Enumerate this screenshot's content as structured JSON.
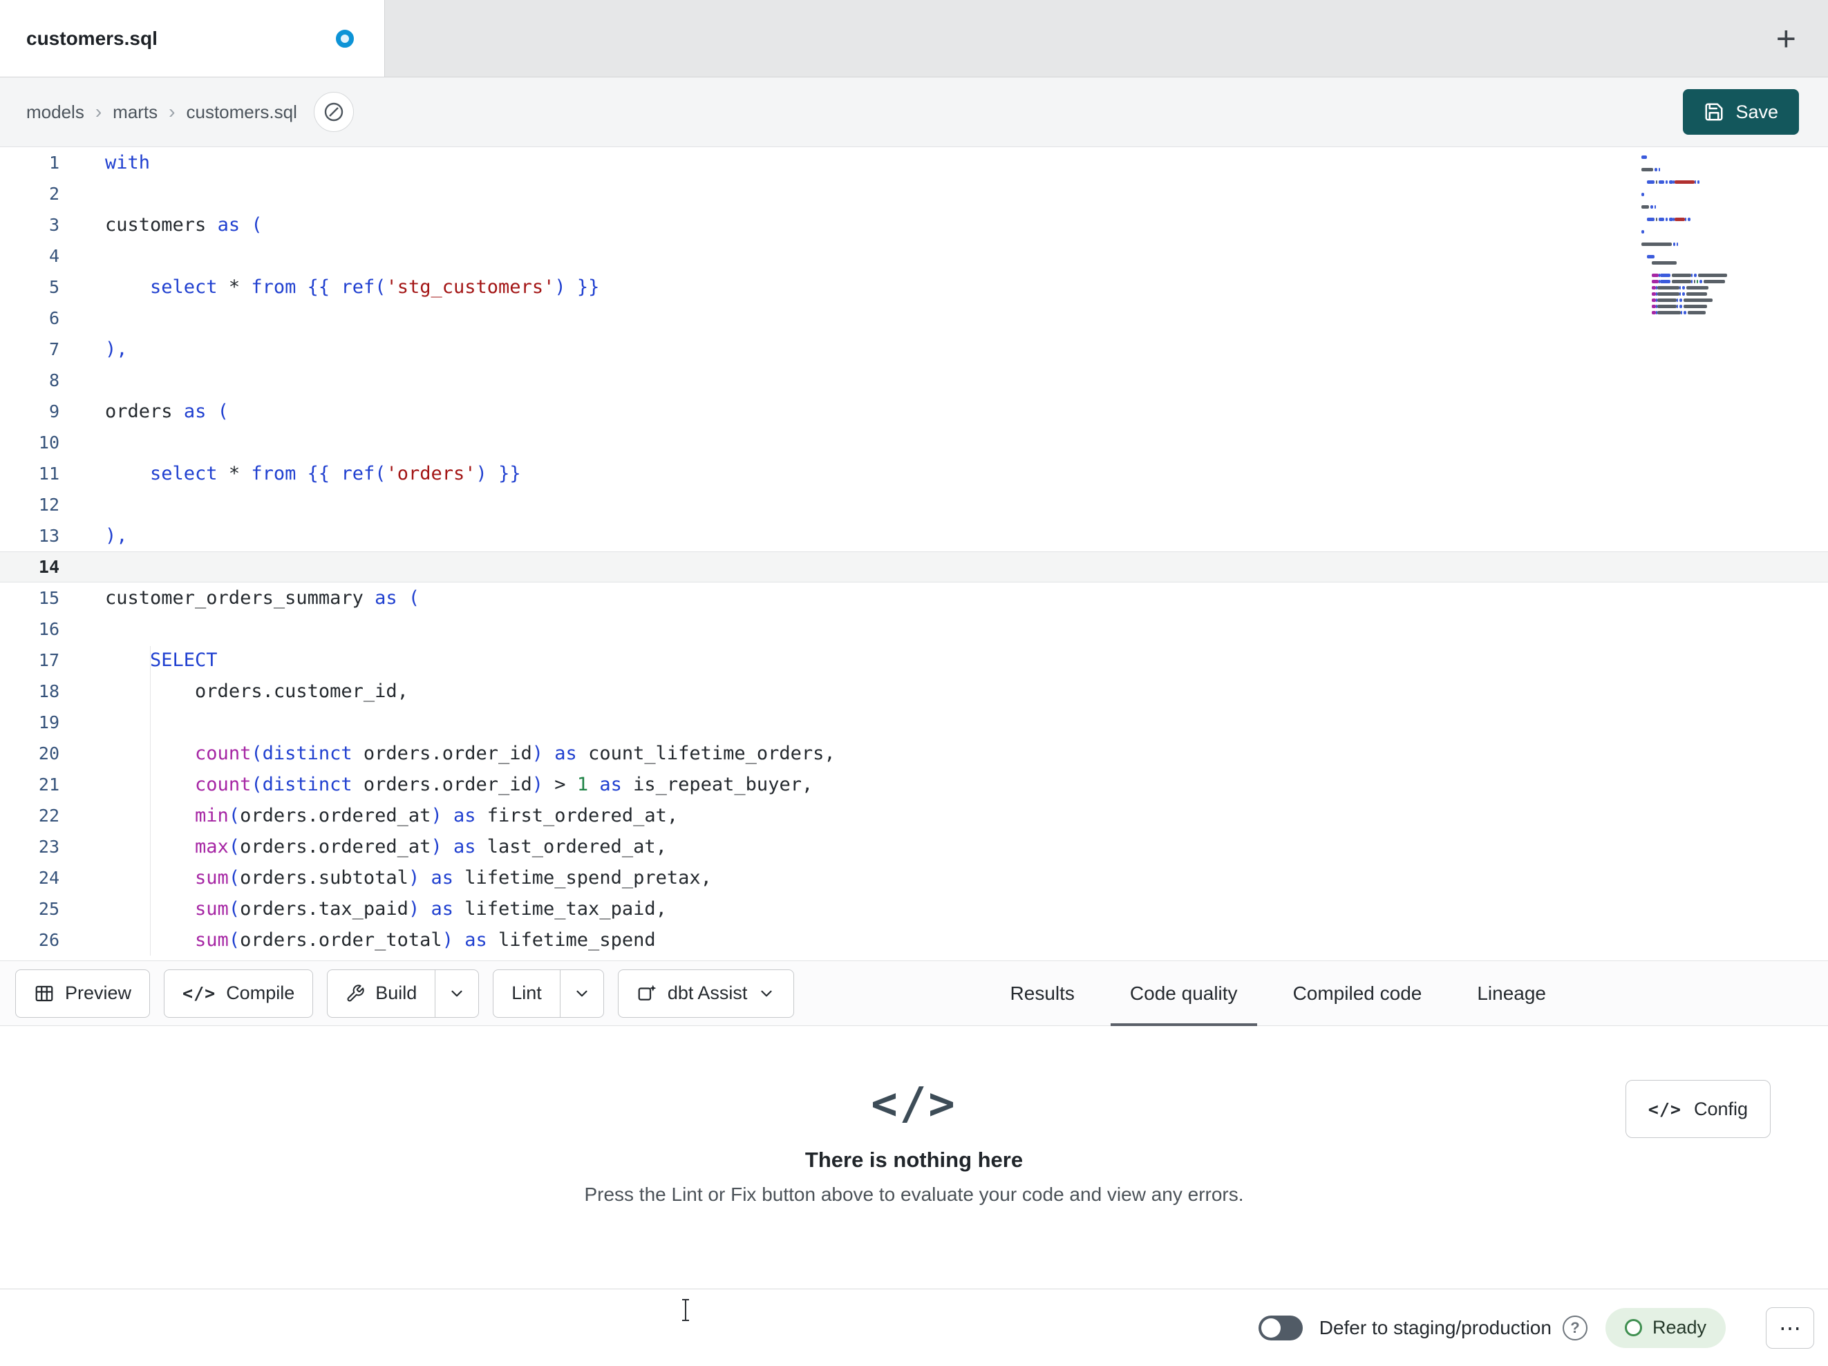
{
  "tab_bar": {
    "active_tab": "customers.sql",
    "new_tab_label": "+"
  },
  "breadcrumb": {
    "items": [
      "models",
      "marts",
      "customers.sql"
    ],
    "separator": "›"
  },
  "save_button": {
    "label": "Save"
  },
  "icons": {
    "code_glyph": "</>"
  },
  "editor": {
    "active_line": 14,
    "lines": [
      {
        "tokens": [
          [
            "with",
            "kw"
          ]
        ]
      },
      {
        "tokens": []
      },
      {
        "tokens": [
          [
            "customers",
            "id"
          ],
          [
            " ",
            "sp"
          ],
          [
            "as",
            "kw"
          ],
          [
            " ",
            "sp"
          ],
          [
            "(",
            "br"
          ]
        ]
      },
      {
        "tokens": []
      },
      {
        "tokens": [
          [
            "    ",
            "sp"
          ],
          [
            "select",
            "kw"
          ],
          [
            " ",
            "sp"
          ],
          [
            "*",
            "op"
          ],
          [
            " ",
            "sp"
          ],
          [
            "from",
            "kw"
          ],
          [
            " ",
            "sp"
          ],
          [
            "{{",
            "jin"
          ],
          [
            " ",
            "sp"
          ],
          [
            "ref",
            "kw"
          ],
          [
            "(",
            "br"
          ],
          [
            "'stg_customers'",
            "str"
          ],
          [
            ")",
            "br"
          ],
          [
            " ",
            "sp"
          ],
          [
            "}}",
            "jin"
          ]
        ]
      },
      {
        "tokens": []
      },
      {
        "tokens": [
          [
            "),",
            "br"
          ]
        ]
      },
      {
        "tokens": []
      },
      {
        "tokens": [
          [
            "orders",
            "id"
          ],
          [
            " ",
            "sp"
          ],
          [
            "as",
            "kw"
          ],
          [
            " ",
            "sp"
          ],
          [
            "(",
            "br"
          ]
        ]
      },
      {
        "tokens": []
      },
      {
        "tokens": [
          [
            "    ",
            "sp"
          ],
          [
            "select",
            "kw"
          ],
          [
            " ",
            "sp"
          ],
          [
            "*",
            "op"
          ],
          [
            " ",
            "sp"
          ],
          [
            "from",
            "kw"
          ],
          [
            " ",
            "sp"
          ],
          [
            "{{",
            "jin"
          ],
          [
            " ",
            "sp"
          ],
          [
            "ref",
            "kw"
          ],
          [
            "(",
            "br"
          ],
          [
            "'orders'",
            "str"
          ],
          [
            ")",
            "br"
          ],
          [
            " ",
            "sp"
          ],
          [
            "}}",
            "jin"
          ]
        ]
      },
      {
        "tokens": []
      },
      {
        "tokens": [
          [
            "),",
            "br"
          ]
        ]
      },
      {
        "tokens": []
      },
      {
        "tokens": [
          [
            "customer_orders_summary",
            "id"
          ],
          [
            " ",
            "sp"
          ],
          [
            "as",
            "kw"
          ],
          [
            " ",
            "sp"
          ],
          [
            "(",
            "br"
          ]
        ]
      },
      {
        "tokens": []
      },
      {
        "tokens": [
          [
            "    ",
            "sp"
          ],
          [
            "SELECT",
            "kw"
          ]
        ]
      },
      {
        "tokens": [
          [
            "        ",
            "sp"
          ],
          [
            "orders.customer_id,",
            "id"
          ]
        ]
      },
      {
        "tokens": []
      },
      {
        "tokens": [
          [
            "        ",
            "sp"
          ],
          [
            "count",
            "fn"
          ],
          [
            "(",
            "br"
          ],
          [
            "distinct",
            "kw"
          ],
          [
            " ",
            "sp"
          ],
          [
            "orders.order_id",
            "id"
          ],
          [
            ")",
            "br"
          ],
          [
            " ",
            "sp"
          ],
          [
            "as",
            "kw"
          ],
          [
            " ",
            "sp"
          ],
          [
            "count_lifetime_orders,",
            "id"
          ]
        ]
      },
      {
        "tokens": [
          [
            "        ",
            "sp"
          ],
          [
            "count",
            "fn"
          ],
          [
            "(",
            "br"
          ],
          [
            "distinct",
            "kw"
          ],
          [
            " ",
            "sp"
          ],
          [
            "orders.order_id",
            "id"
          ],
          [
            ")",
            "br"
          ],
          [
            " ",
            "sp"
          ],
          [
            ">",
            "op"
          ],
          [
            " ",
            "sp"
          ],
          [
            "1",
            "num"
          ],
          [
            " ",
            "sp"
          ],
          [
            "as",
            "kw"
          ],
          [
            " ",
            "sp"
          ],
          [
            "is_repeat_buyer,",
            "id"
          ]
        ]
      },
      {
        "tokens": [
          [
            "        ",
            "sp"
          ],
          [
            "min",
            "fn"
          ],
          [
            "(",
            "br"
          ],
          [
            "orders.ordered_at",
            "id"
          ],
          [
            ")",
            "br"
          ],
          [
            " ",
            "sp"
          ],
          [
            "as",
            "kw"
          ],
          [
            " ",
            "sp"
          ],
          [
            "first_ordered_at,",
            "id"
          ]
        ]
      },
      {
        "tokens": [
          [
            "        ",
            "sp"
          ],
          [
            "max",
            "fn"
          ],
          [
            "(",
            "br"
          ],
          [
            "orders.ordered_at",
            "id"
          ],
          [
            ")",
            "br"
          ],
          [
            " ",
            "sp"
          ],
          [
            "as",
            "kw"
          ],
          [
            " ",
            "sp"
          ],
          [
            "last_ordered_at,",
            "id"
          ]
        ]
      },
      {
        "tokens": [
          [
            "        ",
            "sp"
          ],
          [
            "sum",
            "fn"
          ],
          [
            "(",
            "br"
          ],
          [
            "orders.subtotal",
            "id"
          ],
          [
            ")",
            "br"
          ],
          [
            " ",
            "sp"
          ],
          [
            "as",
            "kw"
          ],
          [
            " ",
            "sp"
          ],
          [
            "lifetime_spend_pretax,",
            "id"
          ]
        ]
      },
      {
        "tokens": [
          [
            "        ",
            "sp"
          ],
          [
            "sum",
            "fn"
          ],
          [
            "(",
            "br"
          ],
          [
            "orders.tax_paid",
            "id"
          ],
          [
            ")",
            "br"
          ],
          [
            " ",
            "sp"
          ],
          [
            "as",
            "kw"
          ],
          [
            " ",
            "sp"
          ],
          [
            "lifetime_tax_paid,",
            "id"
          ]
        ]
      },
      {
        "tokens": [
          [
            "        ",
            "sp"
          ],
          [
            "sum",
            "fn"
          ],
          [
            "(",
            "br"
          ],
          [
            "orders.order_total",
            "id"
          ],
          [
            ")",
            "br"
          ],
          [
            " ",
            "sp"
          ],
          [
            "as",
            "kw"
          ],
          [
            " ",
            "sp"
          ],
          [
            "lifetime_spend",
            "id"
          ]
        ]
      }
    ]
  },
  "action_bar": {
    "preview": "Preview",
    "compile": "Compile",
    "build": "Build",
    "lint": "Lint",
    "assist": "dbt Assist"
  },
  "result_tabs": {
    "items": [
      {
        "label": "Results",
        "active": false
      },
      {
        "label": "Code quality",
        "active": true
      },
      {
        "label": "Compiled code",
        "active": false
      },
      {
        "label": "Lineage",
        "active": false
      }
    ]
  },
  "results_panel": {
    "empty_icon": "</>",
    "title": "There is nothing here",
    "subtitle": "Press the Lint or Fix button above to evaluate your code and view any errors.",
    "config_button": "Config"
  },
  "status_bar": {
    "defer_toggle_on": false,
    "defer_label": "Defer to staging/production",
    "help_icon": "?",
    "ready_label": "Ready",
    "more_label": "⋯"
  }
}
